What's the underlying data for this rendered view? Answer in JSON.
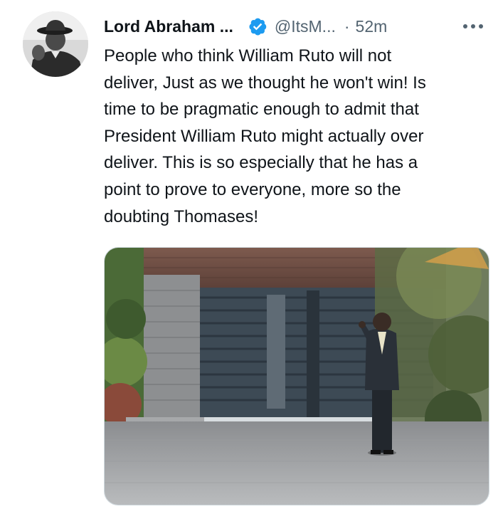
{
  "author": {
    "display_name": "Lord Abraham ...",
    "handle": "@ItsM...",
    "verified_icon": "verified-badge-icon",
    "avatar_icon": "profile-photo"
  },
  "meta": {
    "separator": "·",
    "time": "52m",
    "more_icon": "more-options-icon"
  },
  "tweet": {
    "text": "People who think William Ruto will not\ndeliver, Just as we thought he won't win! Is\ntime to be pragmatic enough to admit that\nPresident William Ruto might actually over\ndeliver. This is so especially that he has a\npoint to prove to everyone, more so the\ndoubting Thomases!"
  },
  "media": {
    "kind": "photo",
    "icon": "attached-photo"
  },
  "colors": {
    "verified": "#1d9bf0",
    "text": "#0f1419",
    "secondary": "#536471"
  }
}
